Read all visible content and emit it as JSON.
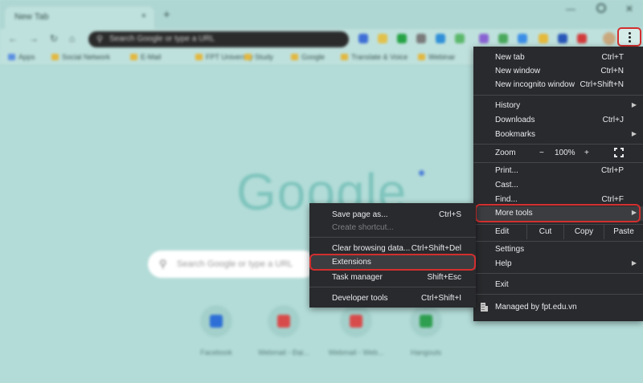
{
  "browser": {
    "tab_title": "New Tab",
    "tab_close": "×",
    "new_tab_glyph": "+",
    "omnibox_placeholder": "Search Google or type a URL",
    "bookmarks": [
      {
        "label": "Apps"
      },
      {
        "label": "Social Network"
      },
      {
        "label": "E-Mail"
      },
      {
        "label": "FPT University"
      },
      {
        "label": "Study"
      },
      {
        "label": "Google"
      },
      {
        "label": "Translate & Voice"
      },
      {
        "label": "Webinar"
      }
    ],
    "page_search_placeholder": "Search Google or type a URL",
    "logo_text": "Google",
    "shortcuts": [
      {
        "label": "Facebook",
        "color": "#2d6fd6"
      },
      {
        "label": "Webmail - Đại...",
        "color": "#d84b4b"
      },
      {
        "label": "Webmail - Web...",
        "color": "#d84b4b"
      },
      {
        "label": "Hangouts",
        "color": "#2e9e4f"
      }
    ]
  },
  "main_menu": {
    "items": [
      {
        "label": "New tab",
        "shortcut": "Ctrl+T"
      },
      {
        "label": "New window",
        "shortcut": "Ctrl+N"
      },
      {
        "label": "New incognito window",
        "shortcut": "Ctrl+Shift+N"
      },
      {
        "label": "History",
        "shortcut": ""
      },
      {
        "label": "Downloads",
        "shortcut": "Ctrl+J"
      },
      {
        "label": "Bookmarks",
        "shortcut": ""
      },
      {
        "label": "Print...",
        "shortcut": "Ctrl+P"
      },
      {
        "label": "Cast...",
        "shortcut": ""
      },
      {
        "label": "Find...",
        "shortcut": "Ctrl+F"
      },
      {
        "label": "More tools",
        "shortcut": ""
      },
      {
        "label": "Settings",
        "shortcut": ""
      },
      {
        "label": "Help",
        "shortcut": ""
      },
      {
        "label": "Exit",
        "shortcut": ""
      }
    ],
    "zoom": {
      "label": "Zoom",
      "minus": "−",
      "value": "100%",
      "plus": "+"
    },
    "edit": {
      "label": "Edit",
      "cut": "Cut",
      "copy": "Copy",
      "paste": "Paste"
    },
    "managed": "Managed by fpt.edu.vn"
  },
  "sub_menu": {
    "items": [
      {
        "label": "Save page as...",
        "shortcut": "Ctrl+S"
      },
      {
        "label": "Create shortcut...",
        "shortcut": ""
      },
      {
        "label": "Clear browsing data...",
        "shortcut": "Ctrl+Shift+Del"
      },
      {
        "label": "Extensions",
        "shortcut": ""
      },
      {
        "label": "Task manager",
        "shortcut": "Shift+Esc"
      },
      {
        "label": "Developer tools",
        "shortcut": "Ctrl+Shift+I"
      }
    ]
  },
  "colors": {
    "menu_bg": "#292a2d",
    "highlight_ring": "#d32f2f",
    "page_bg": "#b3dcd8"
  }
}
